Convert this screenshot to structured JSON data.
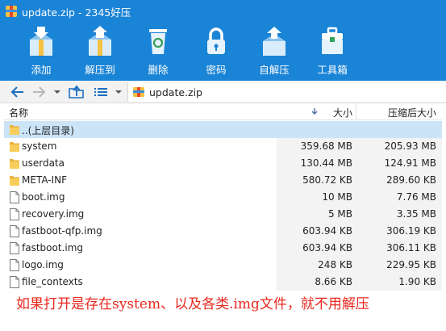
{
  "window": {
    "title": "update.zip - 2345好压"
  },
  "toolbar": {
    "items": [
      {
        "label": "添加",
        "icon": "add-archive-icon"
      },
      {
        "label": "解压到",
        "icon": "extract-to-icon"
      },
      {
        "label": "删除",
        "icon": "recycle-bin-icon"
      },
      {
        "label": "密码",
        "icon": "lock-icon"
      },
      {
        "label": "自解压",
        "icon": "self-extract-icon"
      },
      {
        "label": "工具箱",
        "icon": "toolbox-icon"
      }
    ]
  },
  "navigation": {
    "path": "update.zip"
  },
  "columns": {
    "name": "名称",
    "size": "大小",
    "packed": "压缩后大小"
  },
  "files": [
    {
      "name": "..(上层目录)",
      "size": "",
      "packed": "",
      "type": "parent-folder"
    },
    {
      "name": "system",
      "size": "359.68 MB",
      "packed": "205.93 MB",
      "type": "folder"
    },
    {
      "name": "userdata",
      "size": "130.44 MB",
      "packed": "124.91 MB",
      "type": "folder"
    },
    {
      "name": "META-INF",
      "size": "580.72 KB",
      "packed": "289.60 KB",
      "type": "folder"
    },
    {
      "name": "boot.img",
      "size": "10 MB",
      "packed": "7.76 MB",
      "type": "file"
    },
    {
      "name": "recovery.img",
      "size": "5 MB",
      "packed": "3.35 MB",
      "type": "file"
    },
    {
      "name": "fastboot-qfp.img",
      "size": "603.94 KB",
      "packed": "306.19 KB",
      "type": "file"
    },
    {
      "name": "fastboot.img",
      "size": "603.94 KB",
      "packed": "306.11 KB",
      "type": "file"
    },
    {
      "name": "logo.img",
      "size": "248 KB",
      "packed": "229.95 KB",
      "type": "file"
    },
    {
      "name": "file_contexts",
      "size": "8.66 KB",
      "packed": "1.90 KB",
      "type": "file"
    }
  ],
  "annotation": {
    "text": "如果打开是存在system、以及各类.img文件，就不用解压"
  },
  "colors": {
    "titlebar": "#1a84d6",
    "selected_row": "#cce4f7",
    "annotation": "#e8281e"
  }
}
